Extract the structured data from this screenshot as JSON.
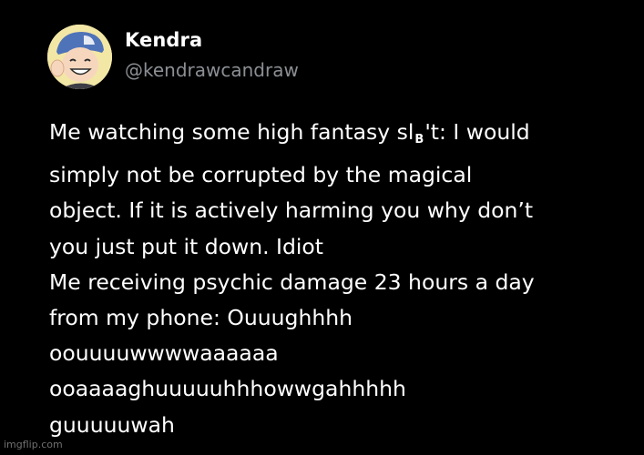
{
  "tweet": {
    "author_name": "Kendra",
    "author_handle": "@kendrawcandraw",
    "lines": [
      {
        "before": "Me watching some high fantasy sl",
        "censor": "B",
        "after": "'t: I would"
      },
      {
        "text": "simply not be corrupted by the magical"
      },
      {
        "text": "object. If it is actively harming you why don’t"
      },
      {
        "text": "you just put it down. Idiot"
      },
      {
        "text": "Me receiving psychic damage 23 hours a day"
      },
      {
        "text": "from my phone: Ouuughhhh"
      },
      {
        "text": "oouuuuwwwwaaaaaa"
      },
      {
        "text": "ooaaaaghuuuuuhhhowwgahhhhh"
      },
      {
        "text": "guuuuuwah"
      }
    ]
  },
  "watermark": "imgflip.com",
  "colors": {
    "background": "#000000",
    "name": "#ffffff",
    "handle": "#8b8f94",
    "body": "#ffffff"
  }
}
